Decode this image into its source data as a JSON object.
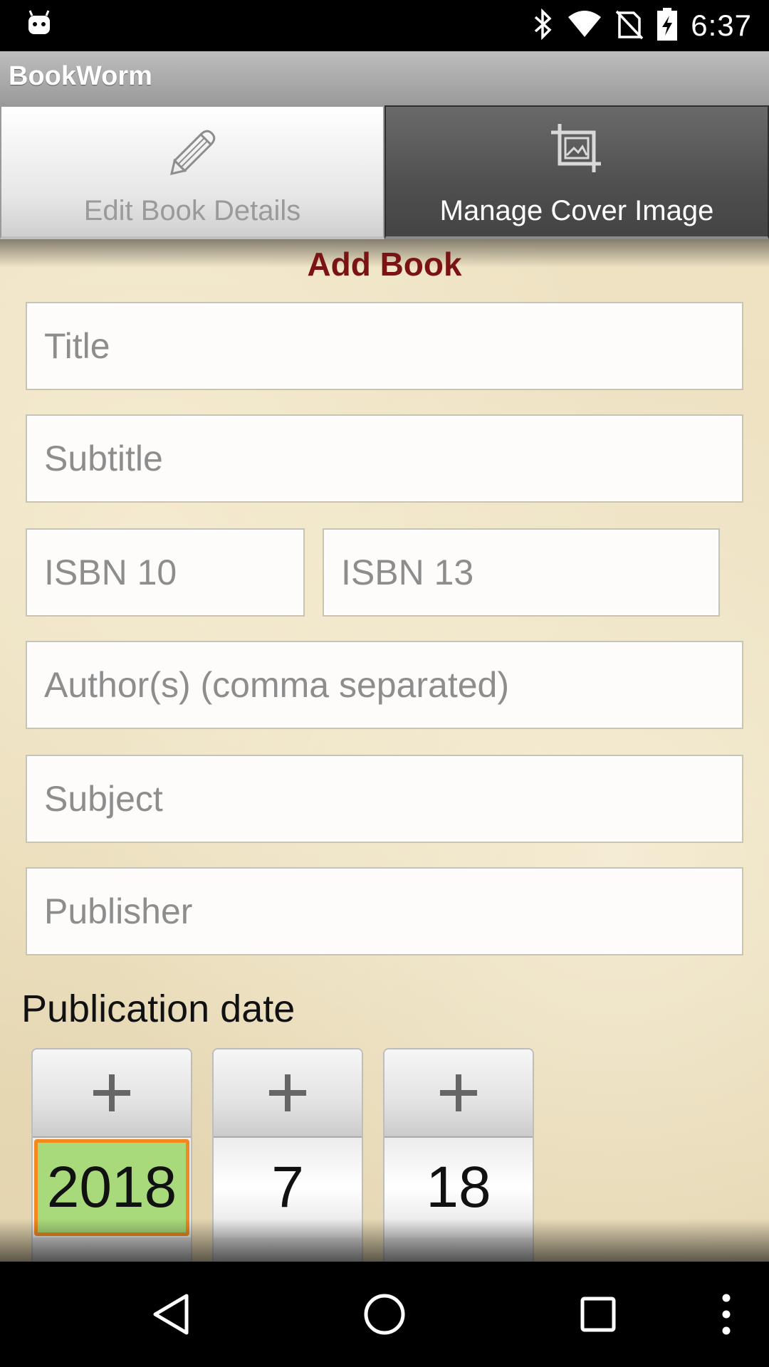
{
  "status_bar": {
    "time": "6:37",
    "icons": [
      "android-debug-icon",
      "bluetooth-icon",
      "wifi-icon",
      "no-sim-icon",
      "battery-charging-icon"
    ]
  },
  "app": {
    "title": "BookWorm"
  },
  "tabs": [
    {
      "label": "Edit Book Details",
      "icon": "pencil-icon",
      "active": true
    },
    {
      "label": "Manage Cover Image",
      "icon": "crop-image-icon",
      "active": false
    }
  ],
  "form": {
    "heading": "Add Book",
    "title_placeholder": "Title",
    "subtitle_placeholder": "Subtitle",
    "isbn10_placeholder": "ISBN 10",
    "isbn13_placeholder": "ISBN 13",
    "authors_placeholder": "Author(s) (comma separated)",
    "subject_placeholder": "Subject",
    "publisher_placeholder": "Publisher",
    "publication_date_label": "Publication date",
    "date": {
      "year": "2018",
      "month": "7",
      "day": "18"
    }
  },
  "colors": {
    "heading": "#7a1414",
    "selected_value_bg": "#a8d97a",
    "selected_value_border": "#f08a1e"
  },
  "nav": [
    "back-icon",
    "home-icon",
    "recents-icon",
    "overflow-menu-icon"
  ]
}
